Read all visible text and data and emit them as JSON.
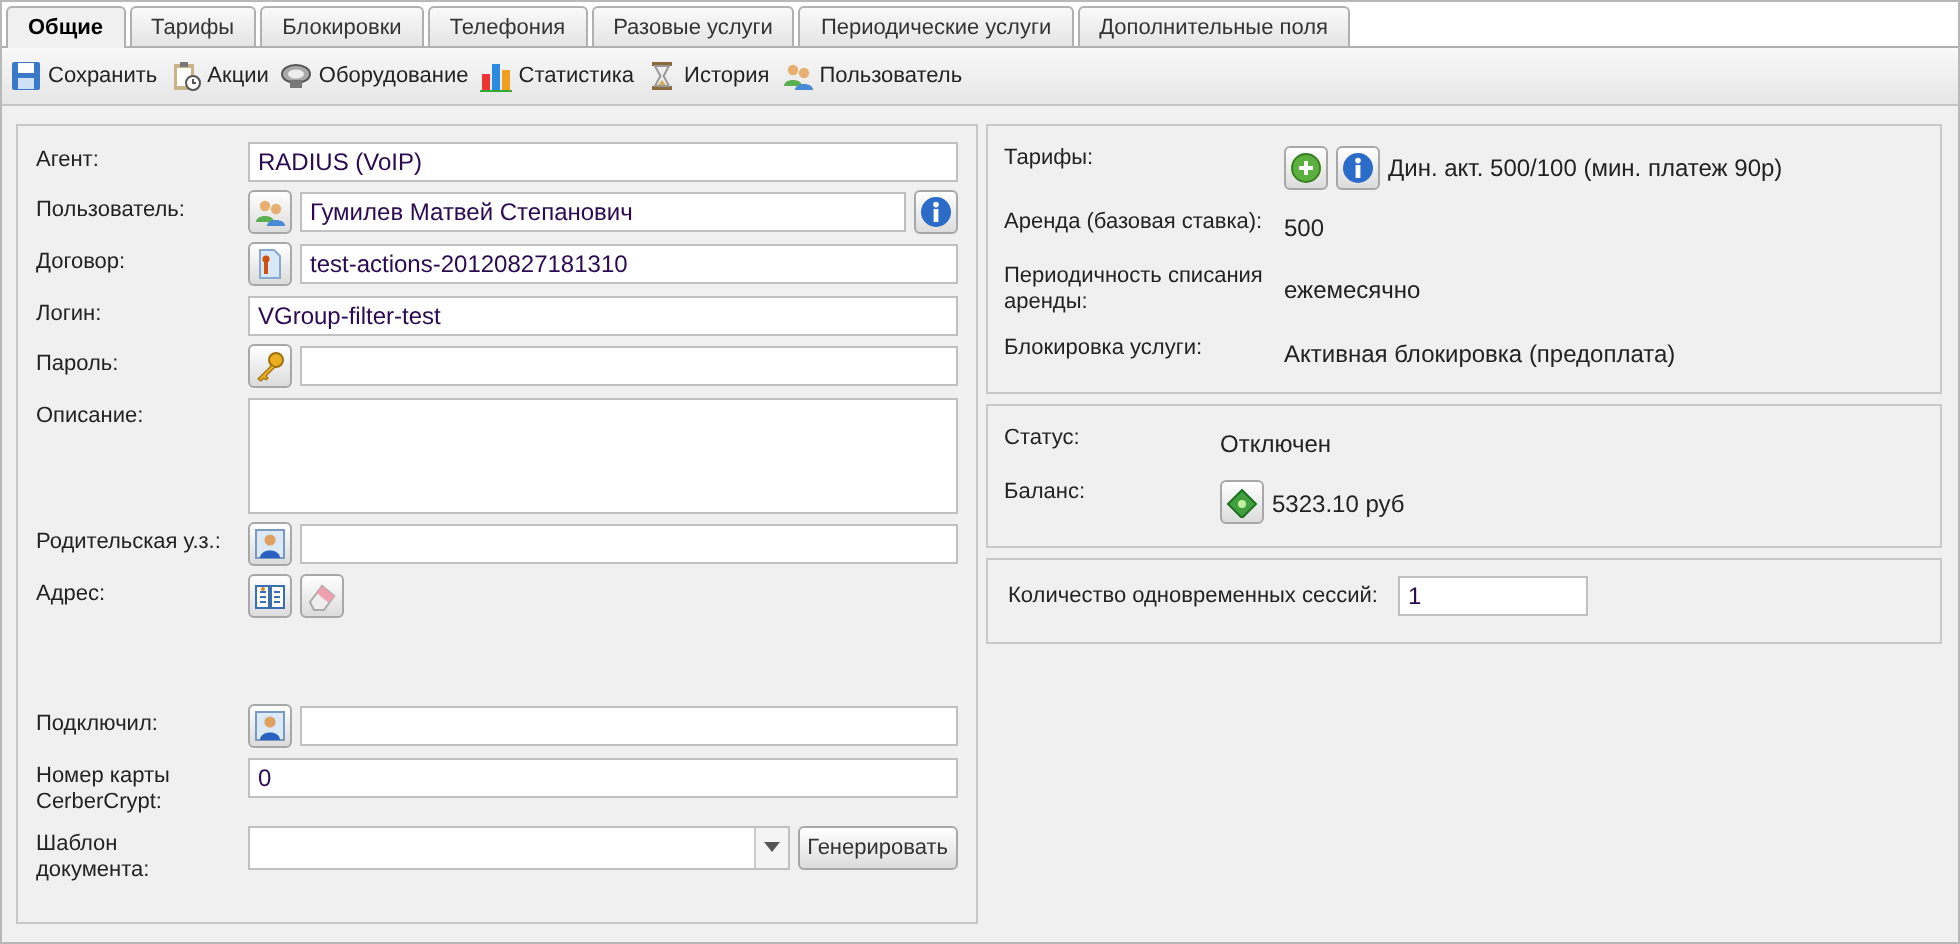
{
  "tabs": [
    {
      "label": "Общие",
      "selected": true
    },
    {
      "label": "Тарифы",
      "selected": false
    },
    {
      "label": "Блокировки",
      "selected": false
    },
    {
      "label": "Телефония",
      "selected": false
    },
    {
      "label": "Разовые услуги",
      "selected": false
    },
    {
      "label": "Периодические услуги",
      "selected": false
    },
    {
      "label": "Дополнительные поля",
      "selected": false
    }
  ],
  "toolbar": [
    {
      "label": "Сохранить"
    },
    {
      "label": "Акции"
    },
    {
      "label": "Оборудование"
    },
    {
      "label": "Статистика"
    },
    {
      "label": "История"
    },
    {
      "label": "Пользователь"
    }
  ],
  "form": [
    {
      "kind": "input",
      "label": "Агент:",
      "value": "RADIUS (VoIP)"
    },
    {
      "kind": "input",
      "label": "Пользователь:",
      "value": "Гумилев Матвей Степанович"
    },
    {
      "kind": "input",
      "label": "Договор:",
      "value": "test-actions-20120827181310"
    },
    {
      "kind": "input",
      "label": "Логин:",
      "value": "VGroup-filter-test"
    },
    {
      "kind": "input",
      "label": "Пароль:"
    },
    {
      "kind": "textarea",
      "label": "Описание:"
    },
    {
      "kind": "input",
      "label": "Родительская у.з.:"
    },
    {
      "kind": "buttons",
      "label": "Адрес:"
    },
    {
      "kind": "input",
      "label": "Подключил:"
    },
    {
      "kind": "input",
      "label": "Номер карты CerberCrypt:",
      "value": "0"
    },
    {
      "kind": "select",
      "label": "Шаблон документа:",
      "button": "Генерировать"
    }
  ],
  "tariff_panel": [
    {
      "label": "Тарифы:",
      "value": "Дин. акт. 500/100 (мин. платеж 90р)"
    },
    {
      "label": "Аренда (базовая ставка):",
      "value": "500"
    },
    {
      "label": "Периодичность списания аренды:",
      "value": "ежемесячно"
    },
    {
      "label": "Блокировка услуги:",
      "value": "Активная блокировка (предоплата)"
    }
  ],
  "status_panel": [
    {
      "label": "Статус:",
      "value": "Отключен"
    },
    {
      "label": "Баланс:",
      "value": "5323.10 руб"
    }
  ],
  "sessions": {
    "label": "Количество одновременных сессий:",
    "value": "1"
  }
}
